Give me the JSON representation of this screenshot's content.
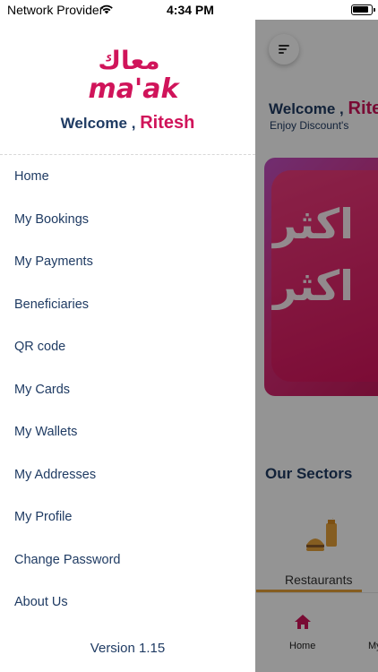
{
  "status_bar": {
    "carrier": "Network Provider",
    "time": "4:34 PM"
  },
  "drawer": {
    "brand": {
      "arabic_mark": "معاك",
      "latin_mark": "ma'ak",
      "color": "#d0145a"
    },
    "welcome_prefix": "Welcome ,",
    "user_name": "Ritesh",
    "items": [
      {
        "label": "Home"
      },
      {
        "label": "My Bookings"
      },
      {
        "label": "My Payments"
      },
      {
        "label": "Beneficiaries"
      },
      {
        "label": "QR code"
      },
      {
        "label": "My Cards"
      },
      {
        "label": "My Wallets"
      },
      {
        "label": "My Addresses"
      },
      {
        "label": "My Profile"
      },
      {
        "label": "Change Password"
      },
      {
        "label": "About Us"
      }
    ],
    "version": "Version 1.15"
  },
  "background_screen": {
    "welcome_prefix": "Welcome ,",
    "user_name": "Rites",
    "subtitle": "Enjoy Discount's",
    "banner_text": "اكثر",
    "sectors_title": "Our Sectors",
    "sector_selected": "Restaurants",
    "tabs": [
      {
        "label": "Home",
        "icon": "home-icon"
      },
      {
        "label": "My"
      }
    ],
    "accent_color": "#e6a13a"
  },
  "colors": {
    "navy_text": "#1f3b63",
    "brand_pink": "#d0145a"
  }
}
